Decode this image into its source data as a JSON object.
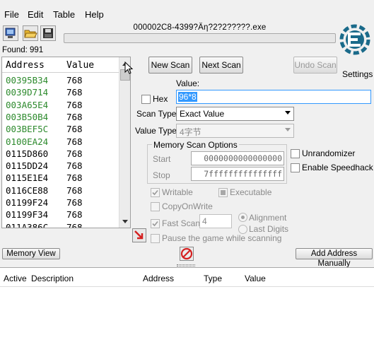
{
  "menu": [
    "File",
    "Edit",
    "Table",
    "Help"
  ],
  "toolbar": {
    "icons": [
      "process-select-icon",
      "open-folder-icon",
      "save-disk-icon"
    ]
  },
  "process_title": "000002C8-4399?Äη?2?2?????.exe",
  "found_label": "Found: 991",
  "list": {
    "headers": {
      "address": "Address",
      "value": "Value"
    },
    "rows": [
      {
        "address": "00395B34",
        "value": "768",
        "color": "#2d8a2d"
      },
      {
        "address": "0039D714",
        "value": "768",
        "color": "#2d8a2d"
      },
      {
        "address": "003A65E4",
        "value": "768",
        "color": "#2d8a2d"
      },
      {
        "address": "003B50B4",
        "value": "768",
        "color": "#2d8a2d"
      },
      {
        "address": "003BEF5C",
        "value": "768",
        "color": "#2d8a2d"
      },
      {
        "address": "0100EA24",
        "value": "768",
        "color": "#2d8a2d"
      },
      {
        "address": "0115D860",
        "value": "768",
        "color": "#000000"
      },
      {
        "address": "0115DD24",
        "value": "768",
        "color": "#000000"
      },
      {
        "address": "0115E1E4",
        "value": "768",
        "color": "#000000"
      },
      {
        "address": "0116CE88",
        "value": "768",
        "color": "#000000"
      },
      {
        "address": "01199F24",
        "value": "768",
        "color": "#000000"
      },
      {
        "address": "01199F34",
        "value": "768",
        "color": "#000000"
      },
      {
        "address": "011A386C",
        "value": "768",
        "color": "#000000"
      }
    ]
  },
  "buttons": {
    "new_scan": "New Scan",
    "next_scan": "Next Scan",
    "undo_scan": "Undo Scan",
    "settings": "Settings",
    "memory_view": "Memory View",
    "add_address": "Add Address Manually"
  },
  "scan": {
    "value_label": "Value:",
    "hex_label": "Hex",
    "value_input": "96*8",
    "scan_type_label": "Scan Type",
    "scan_type_value": "Exact Value",
    "value_type_label": "Value Type",
    "value_type_value": "4字节"
  },
  "memory_options": {
    "title": "Memory Scan Options",
    "start_label": "Start",
    "start_value": "0000000000000000",
    "stop_label": "Stop",
    "stop_value": "7fffffffffffffff",
    "writable": "Writable",
    "executable": "Executable",
    "copy_on_write": "CopyOnWrite",
    "fast_scan": "Fast Scan",
    "fast_scan_value": "4",
    "alignment": "Alignment",
    "last_digits": "Last Digits",
    "pause_game": "Pause the game while scanning"
  },
  "right_options": {
    "unrandomizer": "Unrandomizer",
    "enable_speedhack": "Enable Speedhack"
  },
  "table": {
    "headers": [
      "Active",
      "Description",
      "Address",
      "Type",
      "Value"
    ]
  },
  "colors": {
    "accent": "#1a6a8a",
    "stop_red": "#d42020",
    "selection": "#3399ff"
  }
}
